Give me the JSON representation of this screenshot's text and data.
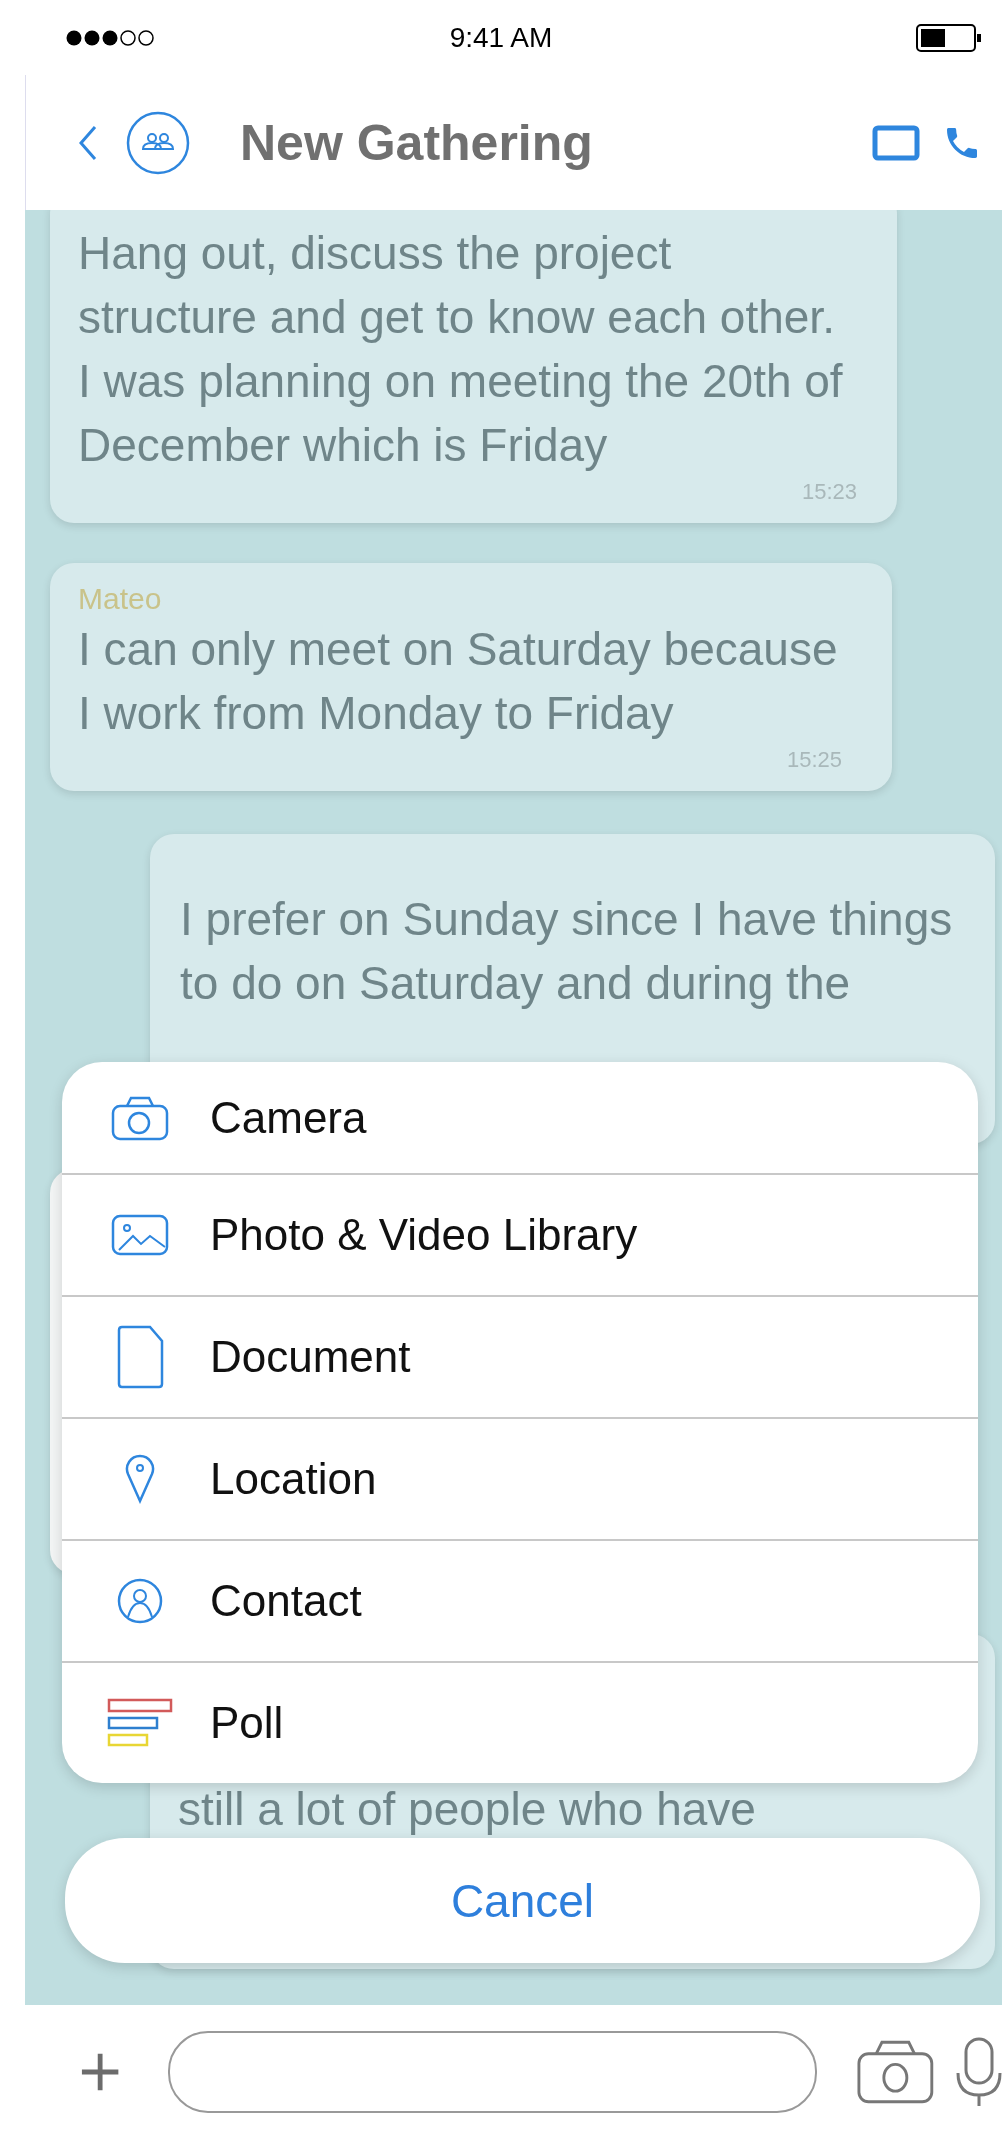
{
  "status_bar": {
    "time": "9:41 AM"
  },
  "header": {
    "title": "New Gathering"
  },
  "messages": [
    {
      "kind": "incoming",
      "text": "Hang out, discuss the project structure and get to know each other. I was planning on meeting the 20th of December which is Friday",
      "time": "15:23"
    },
    {
      "kind": "incoming",
      "sender": "Mateo",
      "text": "I can only meet on Saturday because I work from Monday to Friday",
      "time": "15:25"
    },
    {
      "kind": "outgoing",
      "text": "I prefer on Sunday since I have things to do on Saturday and during the"
    },
    {
      "kind": "covered"
    },
    {
      "kind": "outgoing",
      "text": "still a lot of people who have"
    }
  ],
  "action_sheet": {
    "items": [
      {
        "kind": "camera",
        "label": "Camera"
      },
      {
        "kind": "library",
        "label": "Photo & Video Library"
      },
      {
        "kind": "document",
        "label": "Document"
      },
      {
        "kind": "location",
        "label": "Location"
      },
      {
        "kind": "contact",
        "label": "Contact"
      },
      {
        "kind": "poll",
        "label": "Poll"
      }
    ],
    "cancel": "Cancel"
  }
}
